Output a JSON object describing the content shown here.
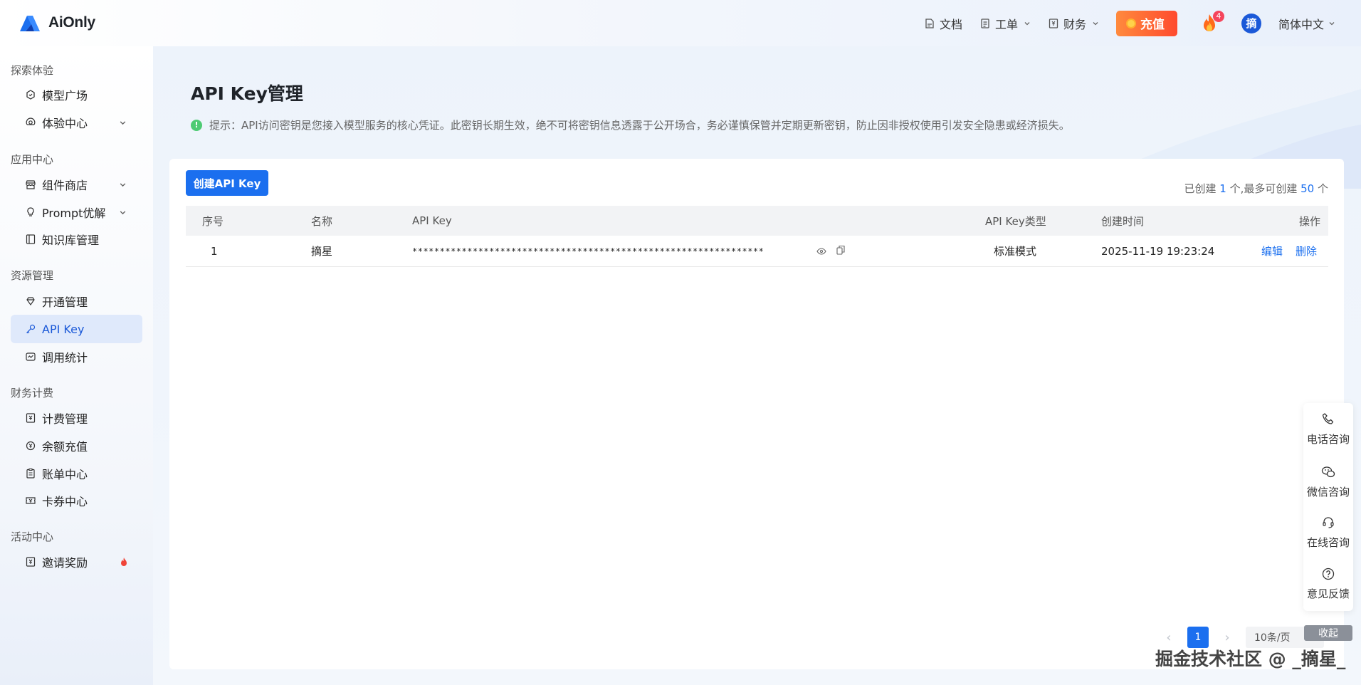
{
  "app": {
    "logo_text": "AiOnly"
  },
  "header": {
    "docs_label": "文档",
    "ticket_label": "工单",
    "finance_label": "财务",
    "recharge_label": "充值",
    "fire_badge": "4",
    "avatar_text": "摘",
    "lang_label": "简体中文"
  },
  "sidebar": {
    "groups": [
      {
        "title": "探索体验",
        "items": [
          {
            "label": "模型广场",
            "icon": "model-plaza-icon"
          },
          {
            "label": "体验中心",
            "icon": "experience-icon",
            "expandable": true
          }
        ]
      },
      {
        "title": "应用中心",
        "items": [
          {
            "label": "组件商店",
            "icon": "store-icon",
            "expandable": true
          },
          {
            "label": "Prompt优解",
            "icon": "bulb-icon",
            "expandable": true
          },
          {
            "label": "知识库管理",
            "icon": "book-icon"
          }
        ]
      },
      {
        "title": "资源管理",
        "items": [
          {
            "label": "开通管理",
            "icon": "diamond-icon"
          },
          {
            "label": "API Key",
            "icon": "key-icon",
            "active": true
          },
          {
            "label": "调用统计",
            "icon": "stats-icon"
          }
        ]
      },
      {
        "title": "财务计费",
        "items": [
          {
            "label": "计费管理",
            "icon": "billing-icon"
          },
          {
            "label": "余额充值",
            "icon": "recharge-icon"
          },
          {
            "label": "账单中心",
            "icon": "bill-icon"
          },
          {
            "label": "卡券中心",
            "icon": "coupon-icon"
          }
        ]
      },
      {
        "title": "活动中心",
        "items": [
          {
            "label": "邀请奖励",
            "icon": "gift-icon",
            "hot": true
          }
        ]
      }
    ]
  },
  "page": {
    "title": "API Key管理",
    "tip": "提示：API访问密钥是您接入模型服务的核心凭证。此密钥长期生效，绝不可将密钥信息透露于公开场合，务必谨慎保管并定期更新密钥，防止因非授权使用引发安全隐患或经济损失。",
    "create_button": "创建API Key",
    "quota": {
      "prefix": "已创建 ",
      "created": "1",
      "middle": " 个,最多可创建 ",
      "max": "50",
      "suffix": " 个"
    }
  },
  "table": {
    "columns": [
      "序号",
      "名称",
      "API Key",
      "API Key类型",
      "创建时间",
      "操作"
    ],
    "rows": [
      {
        "index": "1",
        "name": "摘星",
        "api_key": "****************************************************************",
        "type": "标准模式",
        "created_at": "2025-11-19 19:23:24",
        "edit": "编辑",
        "delete": "删除"
      }
    ]
  },
  "pagination": {
    "prev": "‹",
    "current": "1",
    "next": "›",
    "page_size": "10条/页"
  },
  "float_panel": {
    "phone": "电话咨询",
    "wechat": "微信咨询",
    "online": "在线咨询",
    "feedback": "意见反馈",
    "collapse": "收起"
  },
  "watermark": "掘金技术社区 @ _摘星_",
  "colors": {
    "primary": "#1b6fef",
    "recharge": "#ff5a2e",
    "tip_icon": "#4ecb73"
  }
}
